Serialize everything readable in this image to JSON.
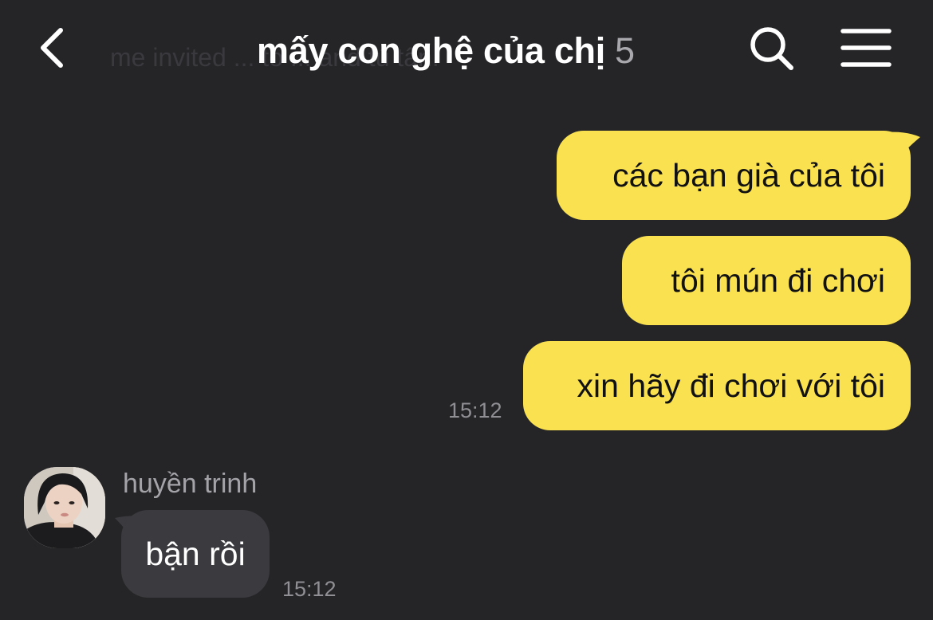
{
  "header": {
    "ghost_notice": "me invited ... to ... and tú tân.",
    "title": "mấy con ghệ của chị",
    "member_count": "5",
    "icons": {
      "back": "chevron-left-icon",
      "search": "search-icon",
      "menu": "hamburger-menu-icon"
    }
  },
  "messages": {
    "outgoing": [
      {
        "text": "các bạn già của tôi"
      },
      {
        "text": "tôi mún đi chơi"
      },
      {
        "text": "xin hãy đi chơi với tôi"
      }
    ],
    "outgoing_time": "15:12",
    "incoming": {
      "sender": "huyền trinh",
      "text": "bận rồi",
      "time": "15:12"
    }
  },
  "colors": {
    "background": "#252528",
    "outgoing_bubble": "#fae150",
    "incoming_bubble": "#3b3b3f",
    "timestamp": "#8f8f94"
  }
}
